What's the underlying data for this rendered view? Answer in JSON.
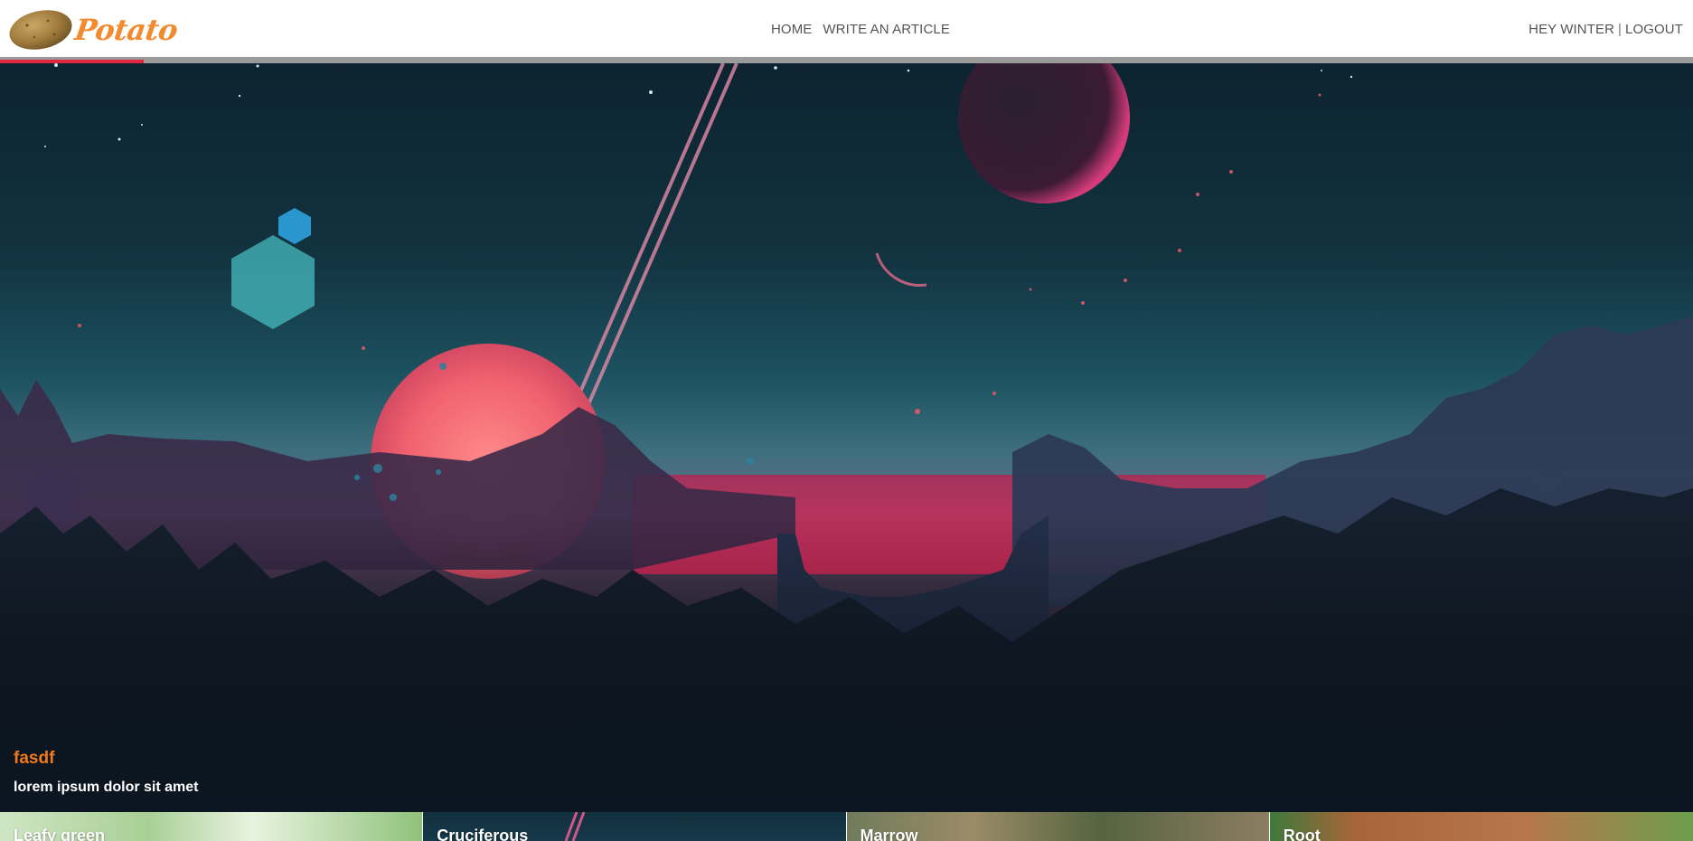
{
  "header": {
    "logo": {
      "text": "Potato",
      "icon": "potato-icon"
    },
    "nav": [
      {
        "label": "HOME"
      },
      {
        "label": "WRITE AN ARTICLE"
      }
    ],
    "user": {
      "greeting": "HEY WINTER",
      "separator": "|",
      "logout": "LOGOUT"
    },
    "progress_fraction": 0.085
  },
  "hero": {
    "title": "fasdf",
    "text": "lorem ipsum dolor sit amet"
  },
  "categories": [
    {
      "label": "Leafy green"
    },
    {
      "label": "Cruciferous"
    },
    {
      "label": "Marrow"
    },
    {
      "label": "Root"
    }
  ],
  "colors": {
    "accent": "#f27a1a",
    "progress": "#e3263f",
    "nav_text": "#555555"
  }
}
